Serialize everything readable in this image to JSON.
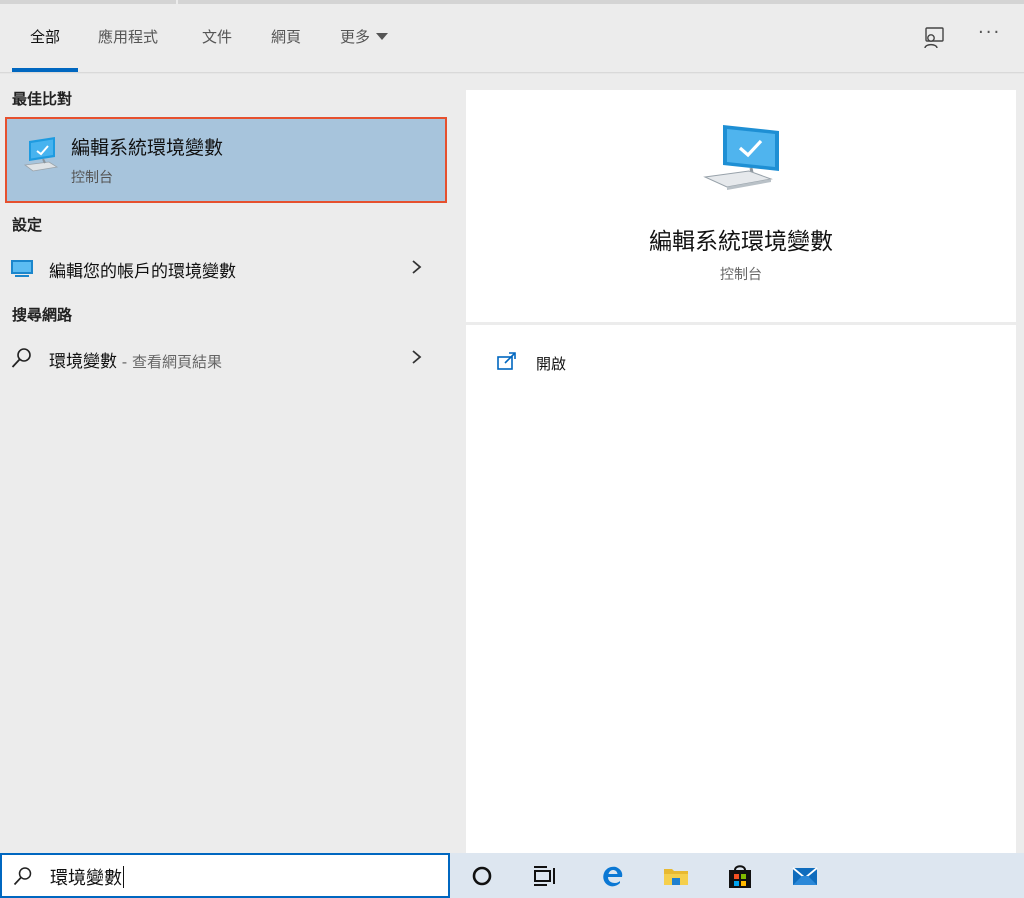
{
  "tabs": [
    {
      "label": "全部",
      "active": true
    },
    {
      "label": "應用程式"
    },
    {
      "label": "文件"
    },
    {
      "label": "網頁"
    },
    {
      "label": "更多"
    }
  ],
  "toolbar": {
    "feedback_icon": "feedback-icon",
    "more_icon": "ellipsis-icon",
    "more_symbol": "···"
  },
  "sections": {
    "best_match": "最佳比對",
    "settings": "設定",
    "web": "搜尋網路"
  },
  "best_match": {
    "title": "編輯系統環境變數",
    "subtitle": "控制台",
    "icon": "system-pc-icon"
  },
  "settings_item": {
    "label": "編輯您的帳戶的環境變數",
    "icon": "monitor-icon"
  },
  "web_item": {
    "query": "環境變數",
    "suffix": " - 查看網頁結果",
    "icon": "search-icon"
  },
  "detail": {
    "title": "編輯系統環境變數",
    "subtitle": "控制台",
    "action_open": "開啟"
  },
  "search": {
    "value": "環境變數"
  },
  "taskbar": [
    "cortana-icon",
    "task-view-icon",
    "edge-icon",
    "file-explorer-icon",
    "store-icon",
    "mail-icon"
  ],
  "colors": {
    "accent": "#0067c0",
    "selection": "#a7c4dc",
    "highlight_border": "#e6502e"
  }
}
